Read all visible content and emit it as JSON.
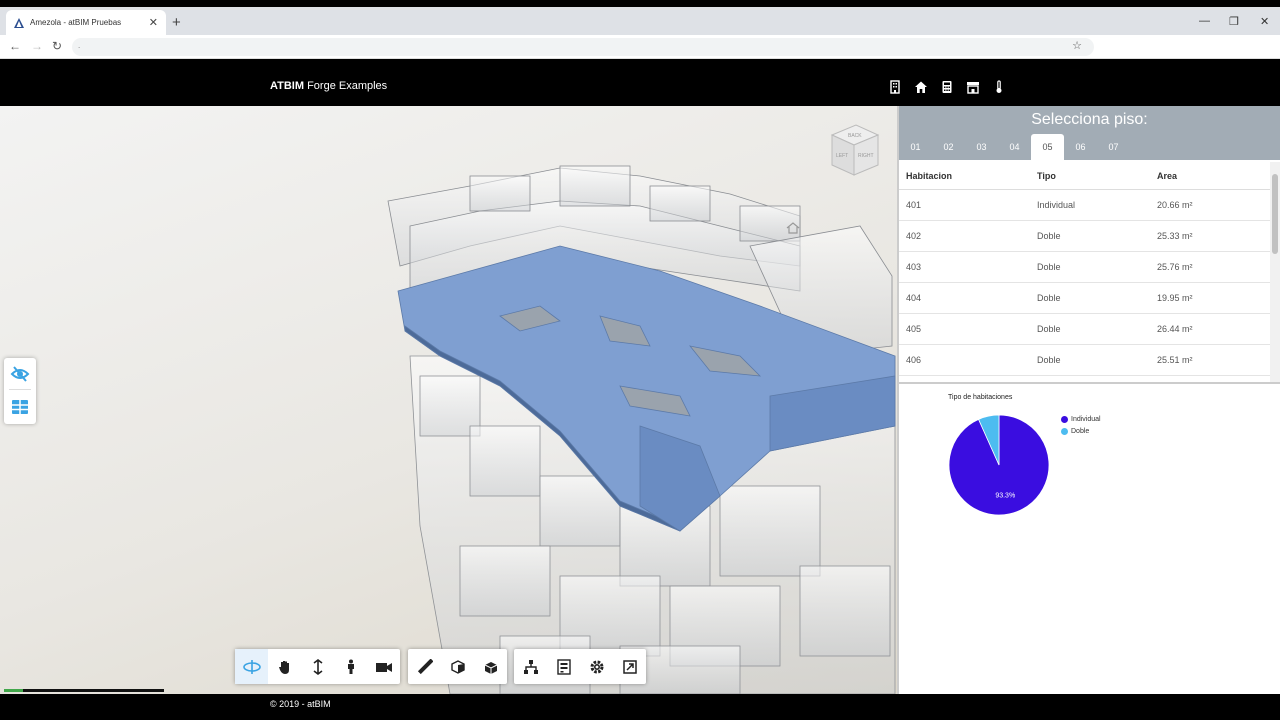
{
  "browser": {
    "tab_title": "Amezola - atBIM Pruebas",
    "tab_close": "✕",
    "new_tab": "+",
    "window_controls": [
      "—",
      "❐",
      "✕"
    ],
    "nav": [
      "←",
      "→",
      "↻"
    ],
    "address": ".",
    "star": "☆"
  },
  "header": {
    "brand_bold": "ATBIM",
    "brand_rest": " Forge Examples",
    "icons": [
      "building-icon",
      "home-icon",
      "calculator-icon",
      "store-icon",
      "thermometer-icon"
    ]
  },
  "viewer": {
    "viewcube_faces": [
      "BACK",
      "LEFT",
      "RIGHT"
    ],
    "progress": 0.12,
    "accent": "#7f9fd1",
    "toolbar_groups": [
      [
        "orbit-icon",
        "pan-icon",
        "zoom-icon",
        "first-person-icon",
        "camera-icon"
      ],
      [
        "measure-icon",
        "section-icon",
        "explode-icon"
      ],
      [
        "model-browser-icon",
        "properties-icon",
        "settings-icon",
        "fullscreen-icon"
      ]
    ]
  },
  "panel": {
    "title": "Selecciona piso:",
    "floors": [
      "01",
      "02",
      "03",
      "04",
      "05",
      "06",
      "07"
    ],
    "selected_floor": "05",
    "columns": [
      "Habitacion",
      "Tipo",
      "Area"
    ],
    "rows": [
      [
        "401",
        "Individual",
        "20.66 m²"
      ],
      [
        "402",
        "Doble",
        "25.33 m²"
      ],
      [
        "403",
        "Doble",
        "25.76 m²"
      ],
      [
        "404",
        "Doble",
        "19.95 m²"
      ],
      [
        "405",
        "Doble",
        "26.44 m²"
      ],
      [
        "406",
        "Doble",
        "25.51 m²"
      ]
    ]
  },
  "chart_data": {
    "type": "pie",
    "title": "Tipo de habitaciones",
    "labels": [
      "Individual",
      "Doble"
    ],
    "values": [
      93.3,
      6.7
    ],
    "colors": [
      "#3a0de0",
      "#4dbcf0"
    ],
    "data_labels": [
      "93.3%",
      ""
    ]
  },
  "footer": {
    "text": "© 2019 - atBIM"
  }
}
